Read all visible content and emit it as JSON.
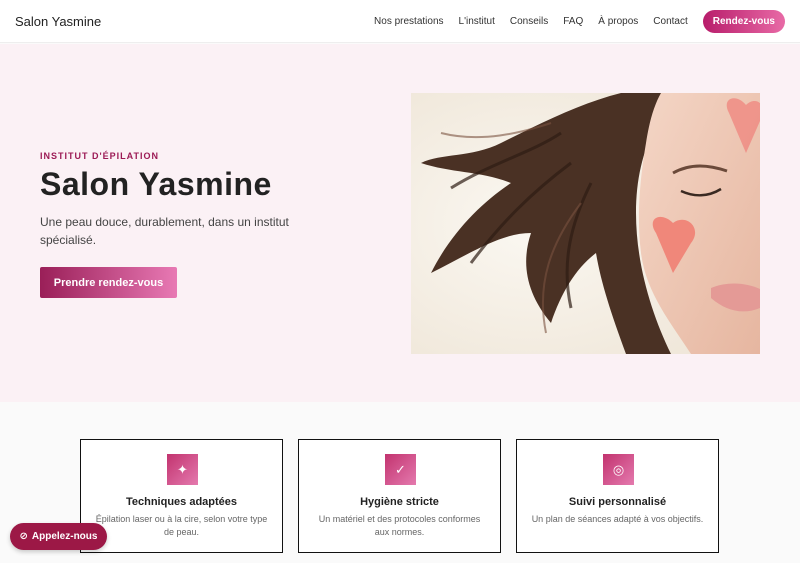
{
  "nav": {
    "brand": "Salon Yasmine",
    "links": [
      "Nos prestations",
      "L'institut",
      "Conseils",
      "FAQ",
      "À propos",
      "Contact"
    ],
    "cta": "Rendez-vous"
  },
  "hero": {
    "eyebrow": "INSTITUT D'ÉPILATION",
    "title": "Salon Yasmine",
    "lead": "Une peau douce, durablement, dans un institut spécialisé.",
    "button": "Prendre rendez-vous"
  },
  "features": [
    {
      "icon": "sparkle-icon",
      "glyph": "✦",
      "title": "Techniques adaptées",
      "desc": "Épilation laser ou à la cire, selon votre type de peau."
    },
    {
      "icon": "check-icon",
      "glyph": "✓",
      "title": "Hygiène stricte",
      "desc": "Un matériel et des protocoles conformes aux normes."
    },
    {
      "icon": "target-icon",
      "glyph": "◎",
      "title": "Suivi personnalisé",
      "desc": "Un plan de séances adapté à vos objectifs."
    }
  ],
  "call": {
    "label": "Appelez-nous",
    "icon": "phone-icon"
  },
  "colors": {
    "accent": "#b81d6b",
    "accent_light": "#e86aa6",
    "hero_bg": "#fbf1f5",
    "call_bg": "#9c1846"
  }
}
